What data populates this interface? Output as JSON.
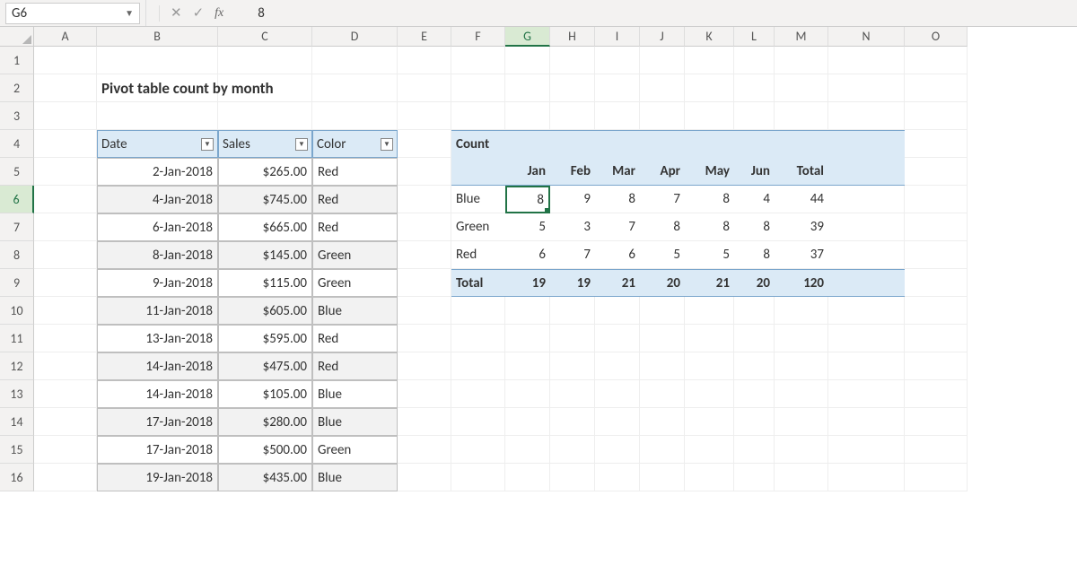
{
  "namebox": "G6",
  "formula_value": "8",
  "columns": [
    "A",
    "B",
    "C",
    "D",
    "E",
    "F",
    "G",
    "H",
    "I",
    "J",
    "K",
    "L",
    "M",
    "N",
    "O"
  ],
  "selected_col": "G",
  "row_numbers": [
    1,
    2,
    3,
    4,
    5,
    6,
    7,
    8,
    9,
    10,
    11,
    12,
    13,
    14,
    15,
    16
  ],
  "selected_row": 6,
  "title": "Pivot table count by month",
  "table": {
    "headers": [
      "Date",
      "Sales",
      "Color"
    ],
    "rows": [
      {
        "date": "2-Jan-2018",
        "sales": "$265.00",
        "color": "Red"
      },
      {
        "date": "4-Jan-2018",
        "sales": "$745.00",
        "color": "Red"
      },
      {
        "date": "6-Jan-2018",
        "sales": "$665.00",
        "color": "Red"
      },
      {
        "date": "8-Jan-2018",
        "sales": "$145.00",
        "color": "Green"
      },
      {
        "date": "9-Jan-2018",
        "sales": "$115.00",
        "color": "Green"
      },
      {
        "date": "11-Jan-2018",
        "sales": "$605.00",
        "color": "Blue"
      },
      {
        "date": "13-Jan-2018",
        "sales": "$595.00",
        "color": "Red"
      },
      {
        "date": "14-Jan-2018",
        "sales": "$475.00",
        "color": "Red"
      },
      {
        "date": "14-Jan-2018",
        "sales": "$105.00",
        "color": "Blue"
      },
      {
        "date": "17-Jan-2018",
        "sales": "$280.00",
        "color": "Blue"
      },
      {
        "date": "17-Jan-2018",
        "sales": "$500.00",
        "color": "Green"
      },
      {
        "date": "19-Jan-2018",
        "sales": "$435.00",
        "color": "Blue"
      }
    ]
  },
  "pivot": {
    "title": "Count",
    "col_headers": [
      "Jan",
      "Feb",
      "Mar",
      "Apr",
      "May",
      "Jun",
      "Total"
    ],
    "rows": [
      {
        "label": "Blue",
        "vals": [
          8,
          9,
          8,
          7,
          8,
          4,
          44
        ]
      },
      {
        "label": "Green",
        "vals": [
          5,
          3,
          7,
          8,
          8,
          8,
          39
        ]
      },
      {
        "label": "Red",
        "vals": [
          6,
          7,
          6,
          5,
          5,
          8,
          37
        ]
      }
    ],
    "total": {
      "label": "Total",
      "vals": [
        19,
        19,
        21,
        20,
        21,
        20,
        120
      ]
    }
  }
}
